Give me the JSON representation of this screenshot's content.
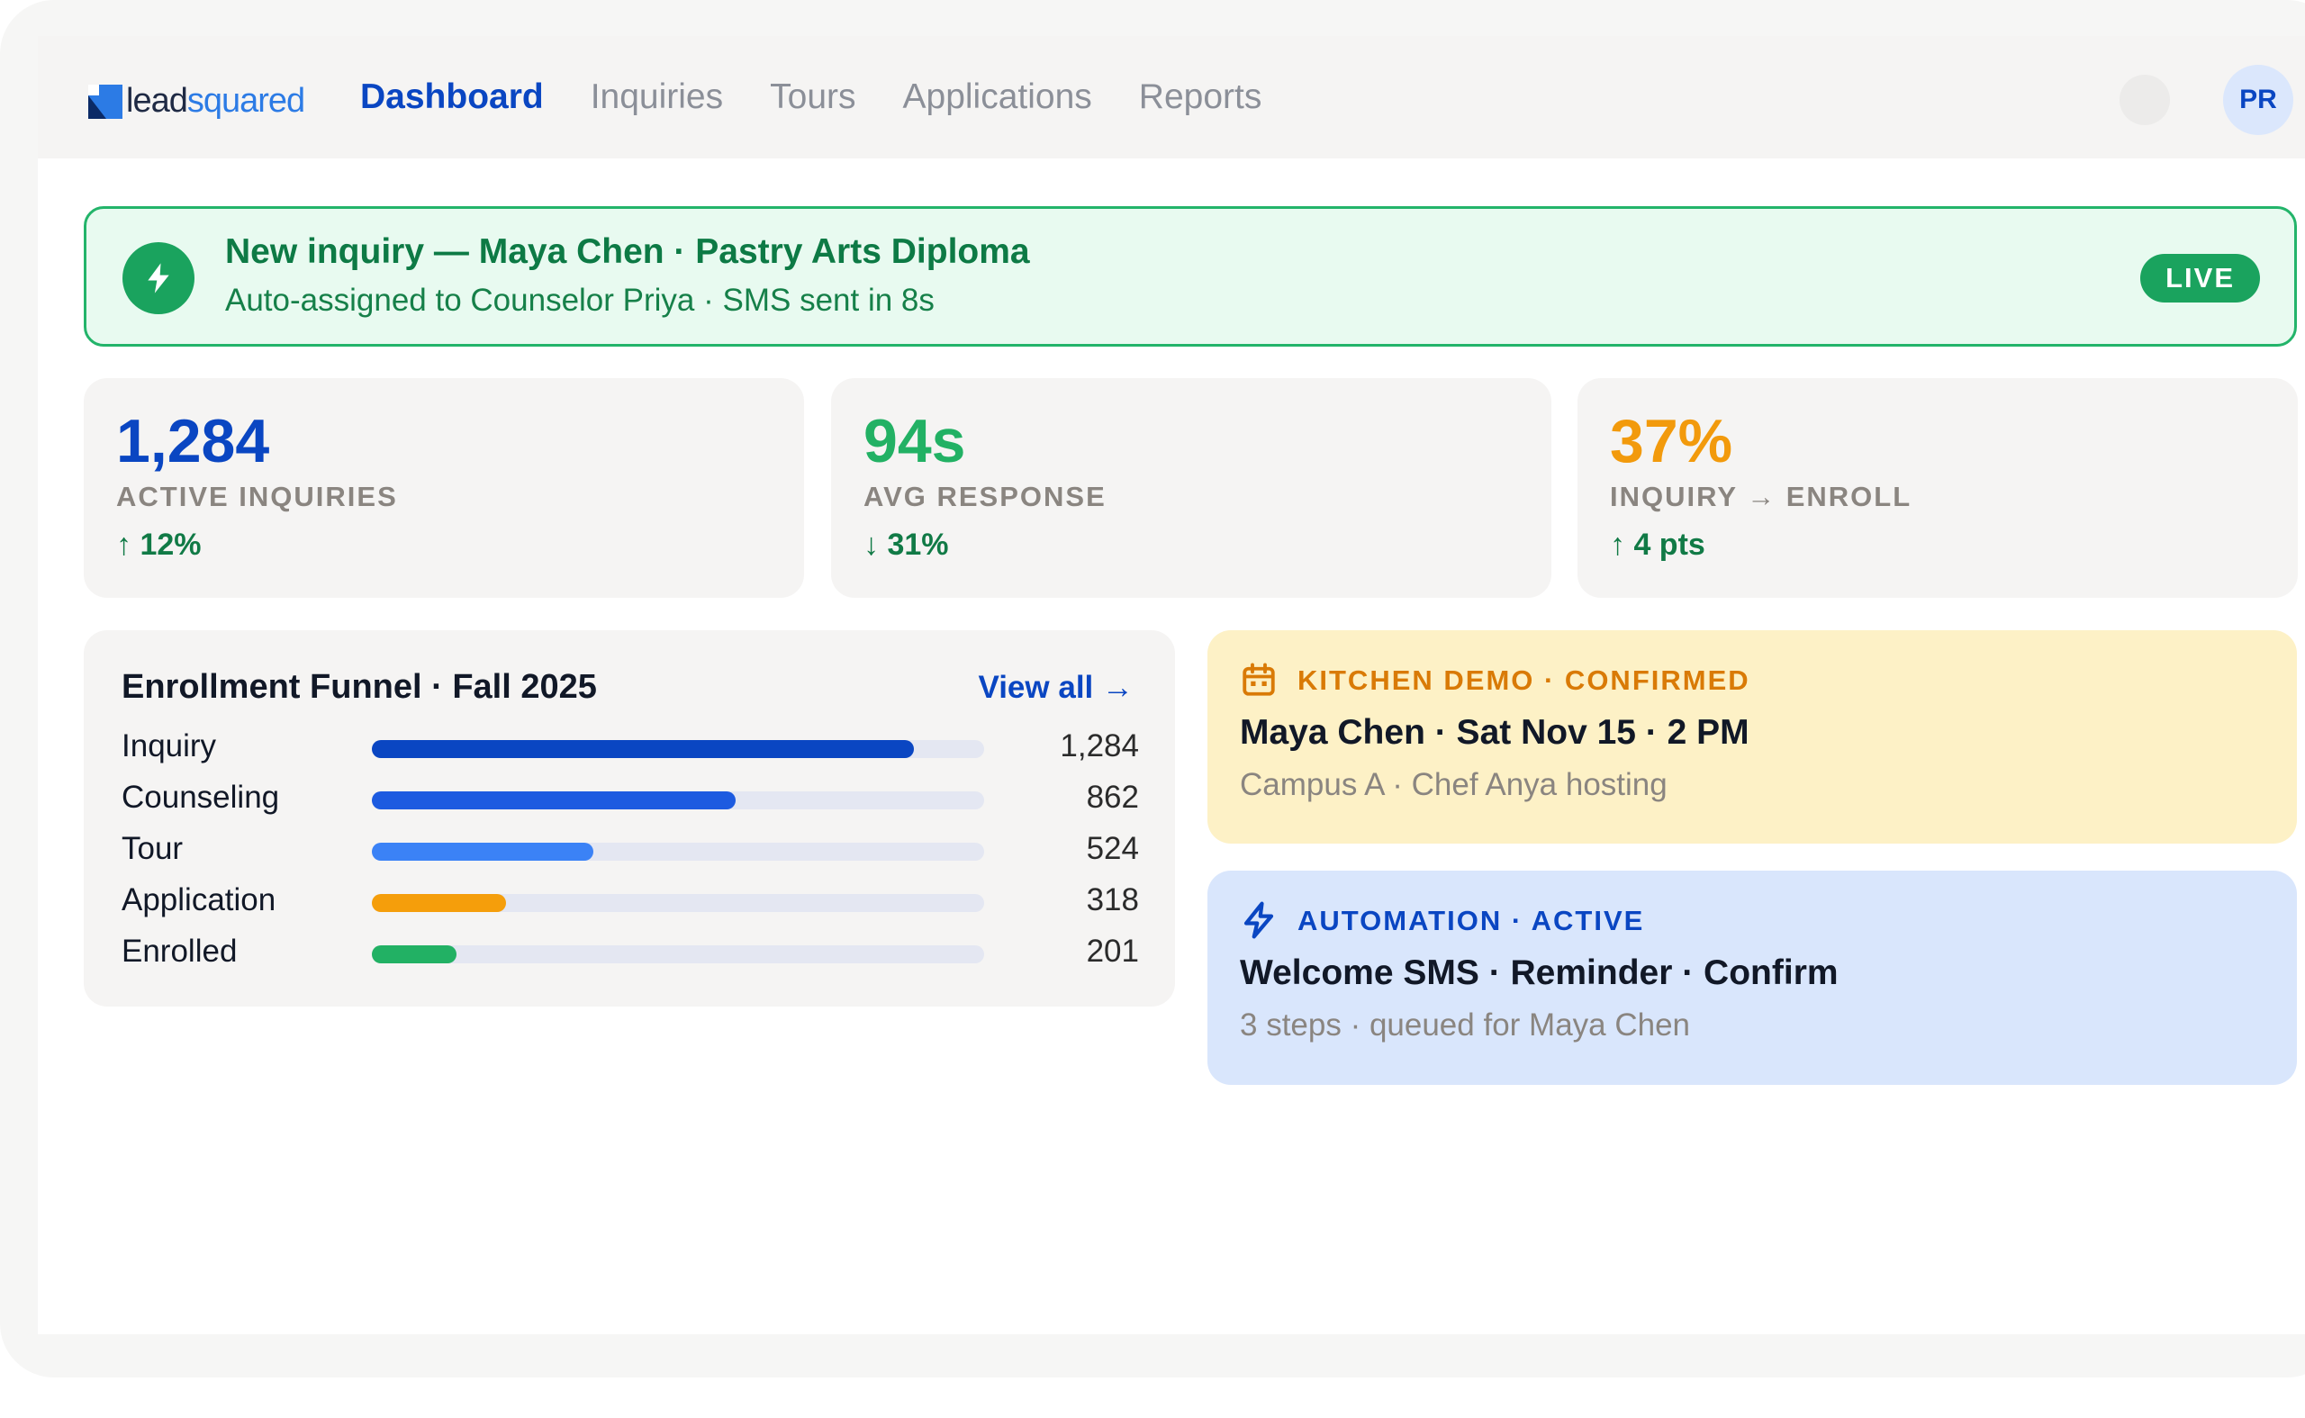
{
  "brand": {
    "logo_text_dark": "lead",
    "logo_text_accent": "squared"
  },
  "nav": {
    "items": [
      {
        "label": "Dashboard",
        "active": true
      },
      {
        "label": "Inquiries",
        "active": false
      },
      {
        "label": "Tours",
        "active": false
      },
      {
        "label": "Applications",
        "active": false
      },
      {
        "label": "Reports",
        "active": false
      }
    ]
  },
  "user": {
    "initials": "PR"
  },
  "alert": {
    "title": "New inquiry — Maya Chen · Pastry Arts Diploma",
    "subtitle": "Auto-assigned to Counselor Priya · SMS sent in 8s",
    "badge": "LIVE",
    "icon": "lightning-icon"
  },
  "stats": [
    {
      "value": "1,284",
      "label": "ACTIVE INQUIRIES",
      "delta": "↑ 12%",
      "color": "#0a46c2"
    },
    {
      "value": "94s",
      "label": "AVG RESPONSE",
      "delta": "↓ 31%",
      "color": "#22b164"
    },
    {
      "value": "37%",
      "label": "INQUIRY → ENROLL",
      "delta": "↑ 4 pts",
      "color": "#f29a0c"
    }
  ],
  "funnel": {
    "title": "Enrollment Funnel · Fall 2025",
    "view_all": "View all →",
    "max": 1284,
    "stages": [
      {
        "label": "Inquiry",
        "count": "1,284",
        "value": 1284,
        "color": "#0a46c2"
      },
      {
        "label": "Counseling",
        "count": "862",
        "value": 862,
        "color": "#1d5be0"
      },
      {
        "label": "Tour",
        "count": "524",
        "value": 524,
        "color": "#3b82f6"
      },
      {
        "label": "Application",
        "count": "318",
        "value": 318,
        "color": "#f59e0b"
      },
      {
        "label": "Enrolled",
        "count": "201",
        "value": 201,
        "color": "#22b164"
      }
    ]
  },
  "demo_card": {
    "tag": "KITCHEN DEMO · CONFIRMED",
    "title": "Maya Chen · Sat Nov 15 · 2 PM",
    "subtitle": "Campus A · Chef Anya hosting",
    "icon": "calendar-icon",
    "accent": "#d97a06"
  },
  "automation_card": {
    "tag": "AUTOMATION · ACTIVE",
    "title": "Welcome SMS · Reminder · Confirm",
    "subtitle": "3 steps · queued for Maya Chen",
    "icon": "lightning-icon",
    "accent": "#0a46c2"
  }
}
